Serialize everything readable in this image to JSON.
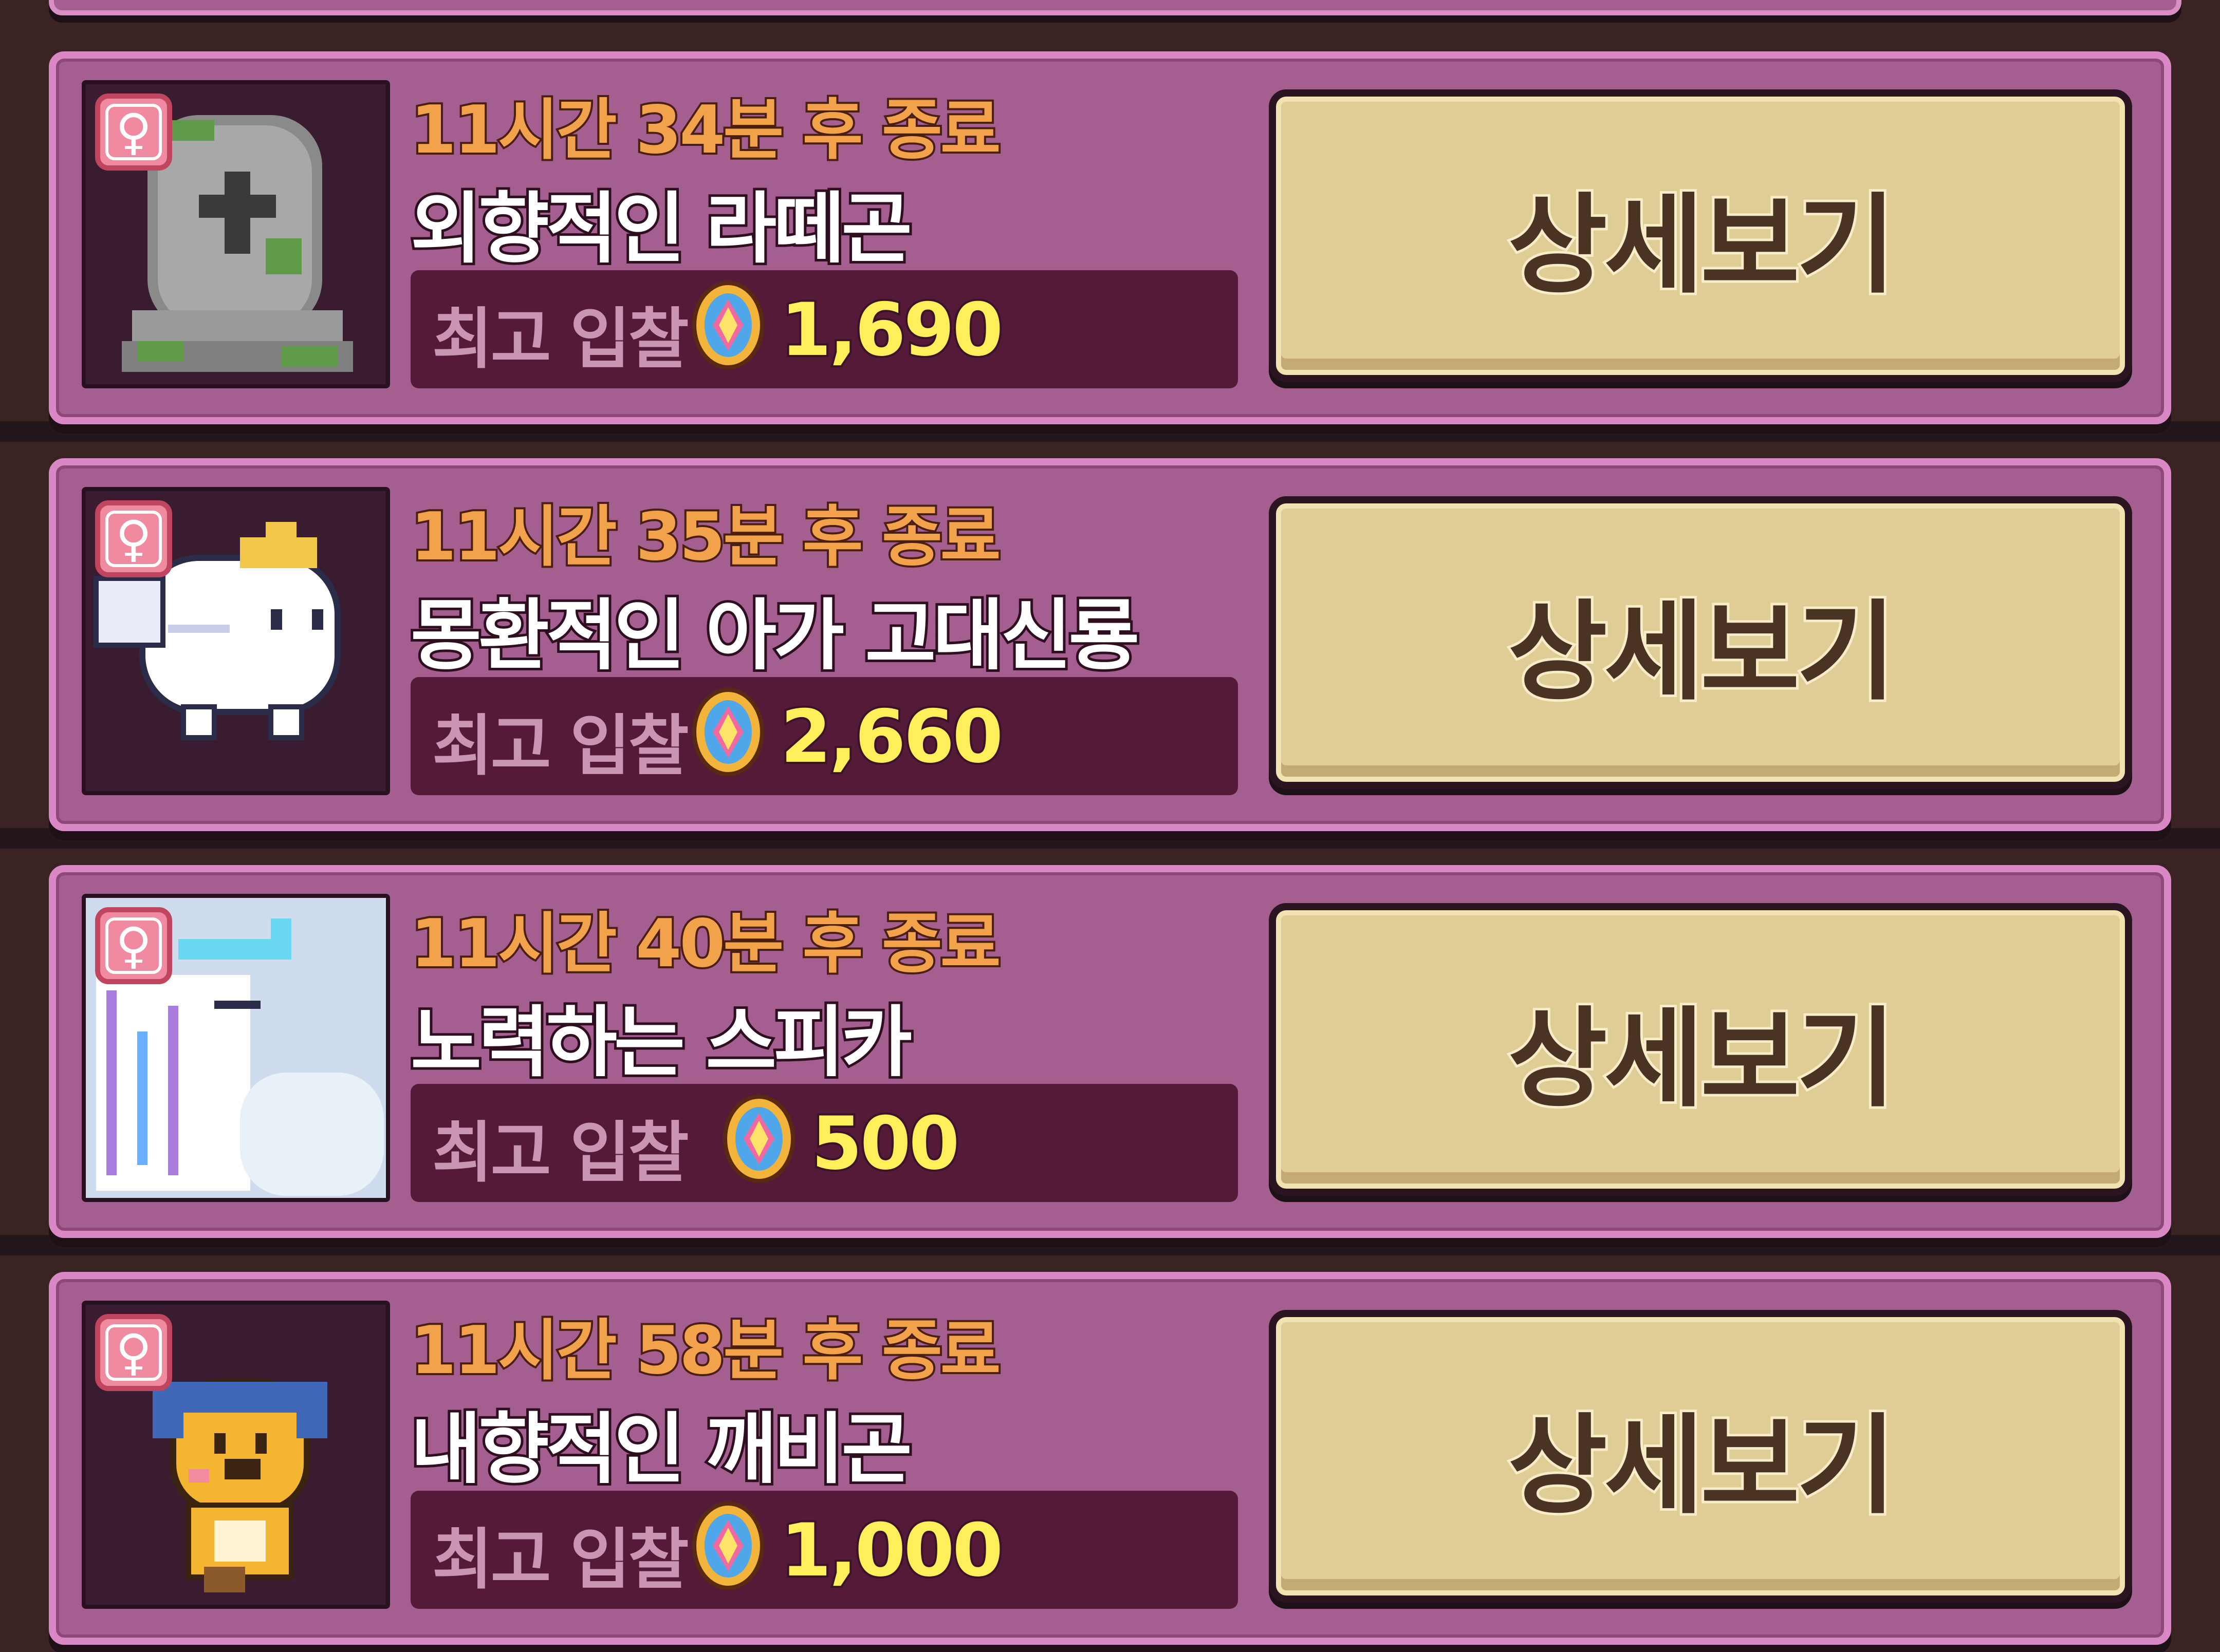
{
  "auction": {
    "items": [
      {
        "gender_icon": "female-icon",
        "gender_symbol": "♀",
        "creature_icon": "tombstone-icon",
        "timer": "11시간 34분 후 종료",
        "name": "외향적인 라떼곤",
        "bid_label": "최고 입찰",
        "currency_icon": "gem-coin-icon",
        "bid_value": "1,690",
        "button_label": "상세보기"
      },
      {
        "gender_icon": "female-icon",
        "gender_symbol": "♀",
        "creature_icon": "white-dragon-icon",
        "timer": "11시간 35분 후 종료",
        "name": "몽환적인 아가 고대신룡",
        "bid_label": "최고 입찰",
        "currency_icon": "gem-coin-icon",
        "bid_value": "2,660",
        "button_label": "상세보기"
      },
      {
        "gender_icon": "female-icon",
        "gender_symbol": "♀",
        "creature_icon": "spirit-dragon-icon",
        "timer": "11시간 40분 후 종료",
        "name": "노력하는 스피카",
        "bid_label": "최고 입찰",
        "currency_icon": "gem-coin-icon",
        "bid_value": "500",
        "button_label": "상세보기"
      },
      {
        "gender_icon": "female-icon",
        "gender_symbol": "♀",
        "creature_icon": "yellow-goblin-icon",
        "timer": "11시간 58분 후 종료",
        "name": "내향적인 깨비곤",
        "bid_label": "최고 입찰",
        "currency_icon": "gem-coin-icon",
        "bid_value": "1,000",
        "button_label": "상세보기"
      }
    ]
  },
  "colors": {
    "card_bg": "#a45f90",
    "card_border": "#d987c5",
    "timer_text": "#f3a24c",
    "bid_value_text": "#ffef5a",
    "button_bg": "#e0cc95"
  }
}
